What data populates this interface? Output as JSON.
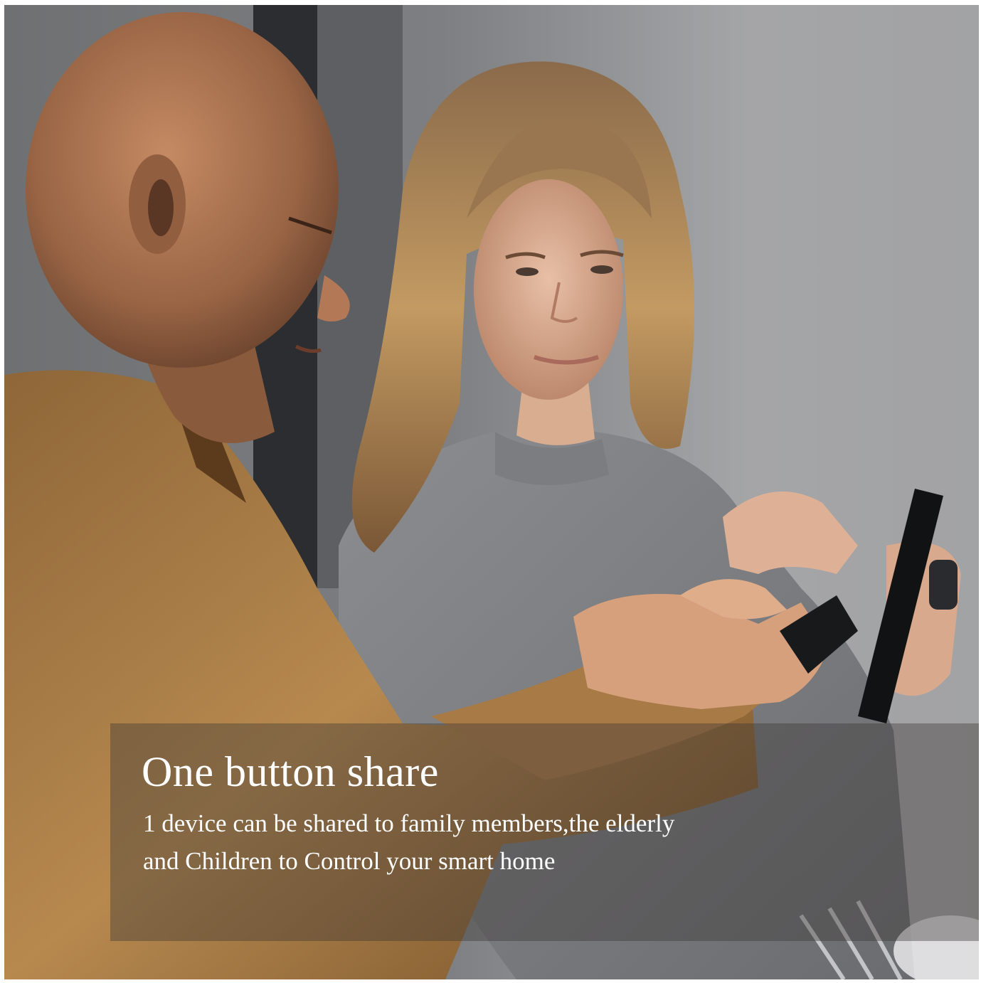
{
  "caption": {
    "headline": "One button share",
    "body_lines": [
      "1 device can be shared to family members,the elderly",
      "and Children to Control your smart home"
    ]
  },
  "colors": {
    "caption_text": "#ffffff",
    "caption_panel": "rgba(60,55,52,0.40)",
    "page_background": "#ffffff"
  }
}
